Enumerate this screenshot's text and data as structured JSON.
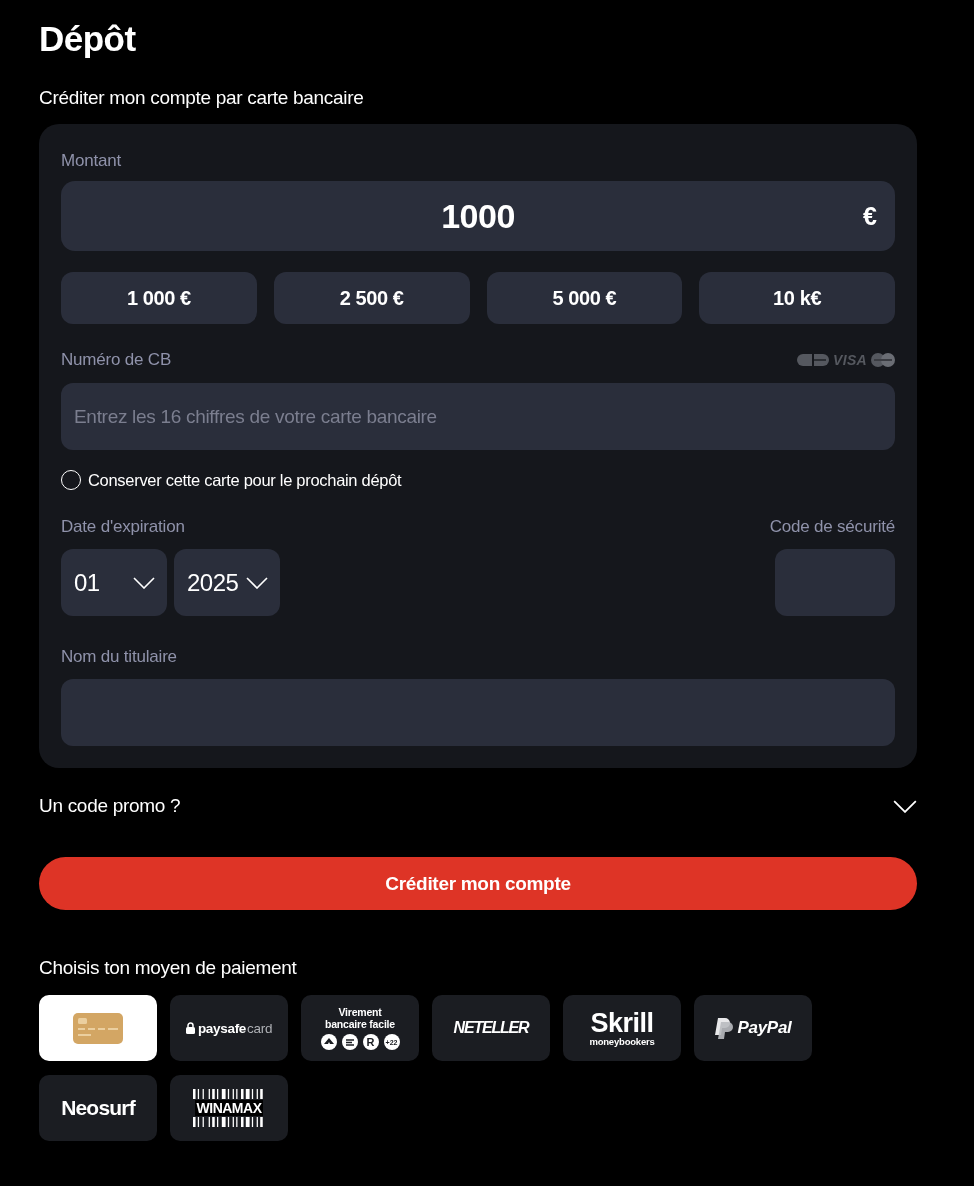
{
  "page": {
    "title": "Dépôt"
  },
  "card_deposit": {
    "heading": "Créditer mon compte par carte bancaire",
    "amount": {
      "label": "Montant",
      "value": "1000",
      "currency": "€"
    },
    "quick_amounts": [
      "1 000 €",
      "2 500 €",
      "5 000 €",
      "10 k€"
    ],
    "card_number": {
      "label": "Numéro de CB",
      "brand_label": "VISA",
      "placeholder": "Entrez les 16 chiffres de votre carte bancaire"
    },
    "save_card": {
      "label": "Conserver cette carte pour le prochain dépôt",
      "checked": false
    },
    "expiry": {
      "label": "Date d'expiration",
      "month": "01",
      "year": "2025"
    },
    "security_code": {
      "label": "Code de sécurité"
    },
    "holder_name": {
      "label": "Nom du titulaire"
    }
  },
  "promo": {
    "label": "Un code promo ?",
    "expanded": false
  },
  "submit_button": "Créditer mon compte",
  "payment_methods": {
    "title": "Choisis ton moyen de paiement",
    "items": [
      {
        "kind": "card",
        "selected": true
      },
      {
        "kind": "paysafecard",
        "text": "paysafe",
        "text_light": "card",
        "selected": false
      },
      {
        "kind": "transfer",
        "text": "Virement\nbancaire facile",
        "badges": [
          {
            "kind": "logo"
          },
          {
            "kind": "logo"
          },
          {
            "kind": "text",
            "text": "R"
          },
          {
            "kind": "text",
            "text": "+22"
          }
        ],
        "selected": false
      },
      {
        "kind": "neteller",
        "text": "NETELLER",
        "selected": false
      },
      {
        "kind": "skrill",
        "text": "Skrill",
        "subtext": "moneybookers",
        "selected": false
      },
      {
        "kind": "paypal",
        "text": "PayPal",
        "selected": false
      },
      {
        "kind": "neosurf",
        "text": "Neosurf",
        "selected": false
      },
      {
        "kind": "winamax",
        "text": "WINAMAX",
        "selected": false
      }
    ]
  }
}
